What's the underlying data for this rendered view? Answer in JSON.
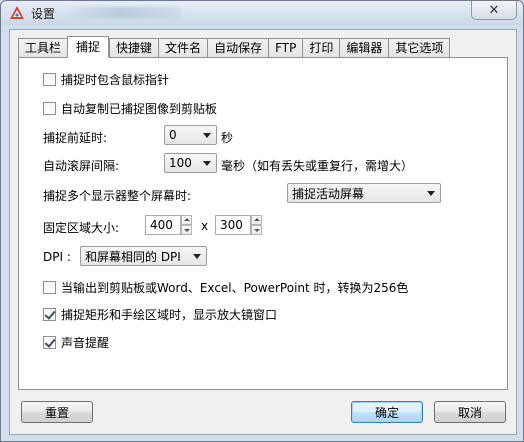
{
  "window": {
    "title": "设置",
    "close_symbol": "✕",
    "icon": "app-logo-icon"
  },
  "tabs": [
    {
      "label": "工具栏",
      "active": false
    },
    {
      "label": "捕捉",
      "active": true
    },
    {
      "label": "快捷键",
      "active": false
    },
    {
      "label": "文件名",
      "active": false
    },
    {
      "label": "自动保存",
      "active": false
    },
    {
      "label": "FTP",
      "active": false
    },
    {
      "label": "打印",
      "active": false
    },
    {
      "label": "编辑器",
      "active": false
    },
    {
      "label": "其它选项",
      "active": false
    }
  ],
  "capture": {
    "include_cursor": {
      "label": "捕捉时包含鼠标指针",
      "checked": false
    },
    "auto_copy": {
      "label": "自动复制已捕捉图像到剪贴板",
      "checked": false
    },
    "delay": {
      "label": "捕捉前延时:",
      "value": "0",
      "unit": "秒"
    },
    "scroll_interval": {
      "label": "自动滚屏间隔:",
      "value": "100",
      "unit": "毫秒（如有丢失或重复行，需增大）"
    },
    "multi_monitor": {
      "label": "捕捉多个显示器整个屏幕时:",
      "value": "捕捉活动屏幕"
    },
    "fixed_size": {
      "label": "固定区域大小:",
      "width": "400",
      "separator": "x",
      "height": "300"
    },
    "dpi": {
      "label": "DPI :",
      "value": "和屏幕相同的 DPI"
    },
    "convert_256": {
      "label": "当输出到剪贴板或Word、Excel、PowerPoint 时，转换为256色",
      "checked": false
    },
    "magnifier": {
      "label": "捕捉矩形和手绘区域时，显示放大镜窗口",
      "checked": true
    },
    "sound": {
      "label": "声音提醒",
      "checked": true
    }
  },
  "buttons": {
    "reset": "重置",
    "ok": "确定",
    "cancel": "取消"
  }
}
